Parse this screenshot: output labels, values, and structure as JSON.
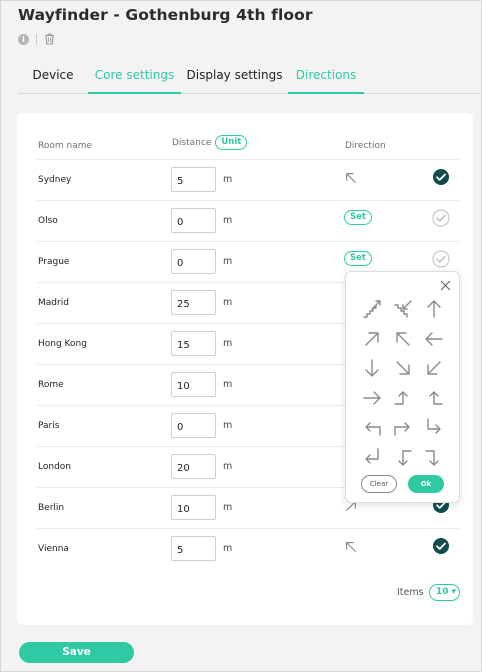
{
  "page": {
    "title": "Wayfinder - Gothenburg 4th floor",
    "info_glyph": "i"
  },
  "colors": {
    "accent": "#2fc9a4",
    "check_done": "#124b4b",
    "check_pending": "#c8c8c8",
    "icon_gray": "#8a8a8a"
  },
  "tabs": [
    {
      "label": "Device",
      "active": false
    },
    {
      "label": "Core settings",
      "active": true
    },
    {
      "label": "Display settings",
      "active": false
    },
    {
      "label": "Directions",
      "active": true
    }
  ],
  "table": {
    "headers": {
      "room": "Room name",
      "distance": "Distance",
      "unit_button": "Unit",
      "direction": "Direction"
    },
    "rows": [
      {
        "room": "Sydney",
        "distance": "5",
        "unit": "m",
        "direction": "arrow-up-left",
        "status": "done"
      },
      {
        "room": "Olso",
        "distance": "0",
        "unit": "m",
        "direction": "set",
        "set_label": "Set",
        "status": "pending"
      },
      {
        "room": "Prague",
        "distance": "0",
        "unit": "m",
        "direction": "set",
        "set_label": "Set",
        "status": "pending"
      },
      {
        "room": "Madrid",
        "distance": "25",
        "unit": "m",
        "direction": "hidden",
        "status": "hidden"
      },
      {
        "room": "Hong Kong",
        "distance": "15",
        "unit": "m",
        "direction": "hidden",
        "status": "hidden"
      },
      {
        "room": "Rome",
        "distance": "10",
        "unit": "m",
        "direction": "hidden",
        "status": "hidden"
      },
      {
        "room": "Paris",
        "distance": "0",
        "unit": "m",
        "direction": "hidden",
        "status": "hidden"
      },
      {
        "room": "London",
        "distance": "20",
        "unit": "m",
        "direction": "hidden",
        "status": "hidden"
      },
      {
        "room": "Berlin",
        "distance": "10",
        "unit": "m",
        "direction": "arrow-up-right",
        "status": "done"
      },
      {
        "room": "Vienna",
        "distance": "5",
        "unit": "m",
        "direction": "arrow-up-left",
        "status": "done"
      }
    ]
  },
  "pagination": {
    "items_label": "Items",
    "items_value": "10 ▾"
  },
  "popup": {
    "close_icon": "close-icon",
    "arrows": [
      "stairs-up-icon",
      "stairs-down-icon",
      "arrow-up-icon",
      "arrow-up-right-icon",
      "arrow-up-left-icon",
      "arrow-left-icon",
      "arrow-down-icon",
      "arrow-down-right-icon",
      "arrow-down-left-icon",
      "arrow-right-icon",
      "turn-right-up-icon",
      "turn-left-up-icon",
      "return-left-icon",
      "return-right-icon",
      "turn-down-right-icon",
      "return-enter-left-icon",
      "turn-down-left-icon",
      "turn-right-down-icon"
    ],
    "clear_label": "Clear",
    "ok_label": "Ok"
  },
  "footer": {
    "save_label": "Save"
  }
}
